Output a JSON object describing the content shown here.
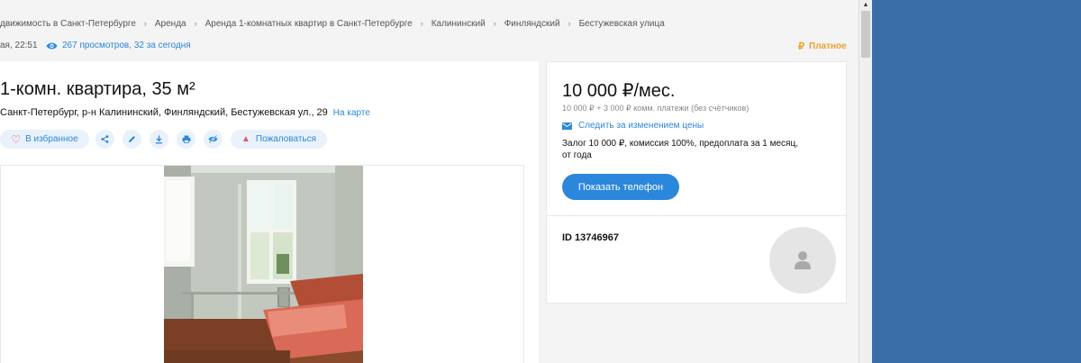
{
  "breadcrumb": [
    "движимость в Санкт-Петербурге",
    "Аренда",
    "Аренда 1-комнатных квартир в Санкт-Петербурге",
    "Калининский",
    "Финляндский",
    "Бестужевская улица"
  ],
  "meta": {
    "date": "ая, 22:51",
    "views": "267 просмотров, 32 за сегодня",
    "paid_label": "Платное",
    "paid_symbol": "₽"
  },
  "listing": {
    "title": "1-комн. квартира, 35 м²",
    "address": "Санкт-Петербург, р-н Калининский, Финляндский, Бестужевская ул., 29",
    "map_link": "На карте"
  },
  "actions": {
    "favorite_label": "В избранное",
    "report_label": "Пожаловаться"
  },
  "price_card": {
    "price": "10 000 ₽/мес.",
    "sub": "10 000 ₽ + 3 000 ₽ комм. платежи (без счётчиков)",
    "track_label": "Следить за изменением цены",
    "deposit_line1": "Залог 10 000 ₽, комиссия 100%, предоплата за 1 месяц,",
    "deposit_line2": "от года",
    "phone_button": "Показать телефон"
  },
  "agent": {
    "id_label": "ID 13746967"
  },
  "colors": {
    "accent": "#2b87db",
    "pill_bg": "#e9f2fb",
    "paid": "#e7a32a",
    "danger": "#e8546b"
  }
}
